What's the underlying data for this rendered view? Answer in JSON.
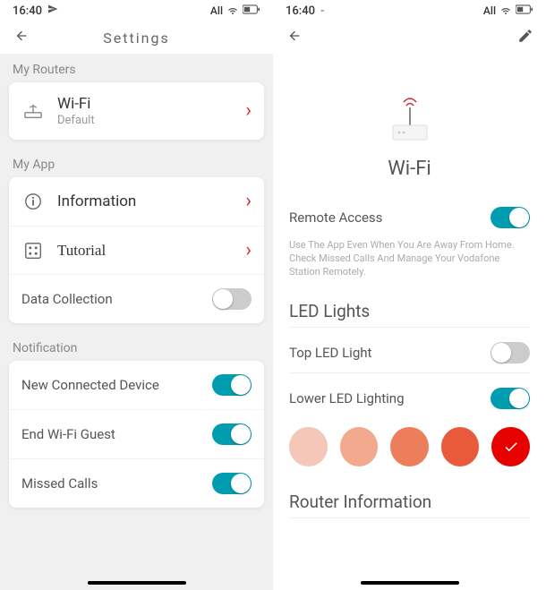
{
  "status": {
    "time": "16:40",
    "signal_text": "All",
    "send_icon": "send-icon",
    "wifi_icon": "wifi-icon",
    "battery_icon": "battery-icon"
  },
  "left": {
    "title": "Settings",
    "my_routers_label": "My Routers",
    "router": {
      "name": "Wi-Fi",
      "sub": "Default"
    },
    "my_app_label": "My App",
    "items": {
      "info": "Information",
      "tutorial": "Tutorial",
      "data_collection": "Data Collection"
    },
    "notification_label": "Notification",
    "notifications": {
      "new_device": "New Connected Device",
      "end_guest": "End Wi-Fi Guest",
      "missed_calls": "Missed Calls"
    }
  },
  "right": {
    "device_name": "Wi-Fi",
    "remote_access": {
      "label": "Remote Access",
      "hint": "Use The App Even When You Are Away From Home. Check Missed Calls And Manage Your Vodafone Station Remotely."
    },
    "led_section": "LED Lights",
    "top_led": "Top LED Light",
    "lower_led": "Lower LED Lighting",
    "colors": [
      "#f5c7b8",
      "#f3a98e",
      "#ec7e5b",
      "#e85a3a",
      "#e60000"
    ],
    "router_info": "Router Information"
  }
}
